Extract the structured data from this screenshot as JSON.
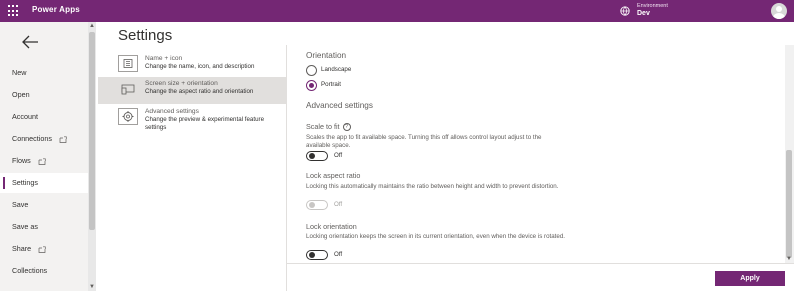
{
  "app": {
    "title": "Power Apps"
  },
  "environment": {
    "label": "Environment",
    "value": "Dev"
  },
  "nav": {
    "items": [
      {
        "label": "New"
      },
      {
        "label": "Open"
      },
      {
        "label": "Account"
      },
      {
        "label": "Connections"
      },
      {
        "label": "Flows"
      },
      {
        "label": "Settings"
      },
      {
        "label": "Save"
      },
      {
        "label": "Save as"
      },
      {
        "label": "Share"
      },
      {
        "label": "Collections"
      }
    ]
  },
  "page": {
    "title": "Settings"
  },
  "categories": [
    {
      "title": "Name + icon",
      "desc": "Change the name, icon, and description",
      "icon": "app-icon"
    },
    {
      "title": "Screen size + orientation",
      "desc": "Change the aspect ratio and orientation",
      "icon": "screen-orientation-icon"
    },
    {
      "title": "Advanced settings",
      "desc": "Change the preview & experimental feature settings",
      "icon": "gear-icon"
    }
  ],
  "orientation": {
    "heading": "Orientation",
    "options": [
      {
        "label": "Landscape",
        "checked": false
      },
      {
        "label": "Portrait",
        "checked": true
      }
    ]
  },
  "advanced": {
    "heading": "Advanced settings",
    "settings": [
      {
        "title": "Scale to fit",
        "desc": "Scales the app to fit available space. Turning this off allows control layout adjust to the available space.",
        "state": "Off",
        "disabled": false
      },
      {
        "title": "Lock aspect ratio",
        "desc": "Locking this automatically maintains the ratio between height and width to prevent distortion.",
        "state": "Off",
        "disabled": true
      },
      {
        "title": "Lock orientation",
        "desc": "Locking orientation keeps the screen in its current orientation, even when the device is rotated.",
        "state": "Off",
        "disabled": false
      }
    ]
  },
  "actions": {
    "apply": "Apply"
  },
  "colors": {
    "brand": "#742774",
    "nav_bg": "#f3f2f1",
    "selected_bg": "#e1dfdd"
  }
}
